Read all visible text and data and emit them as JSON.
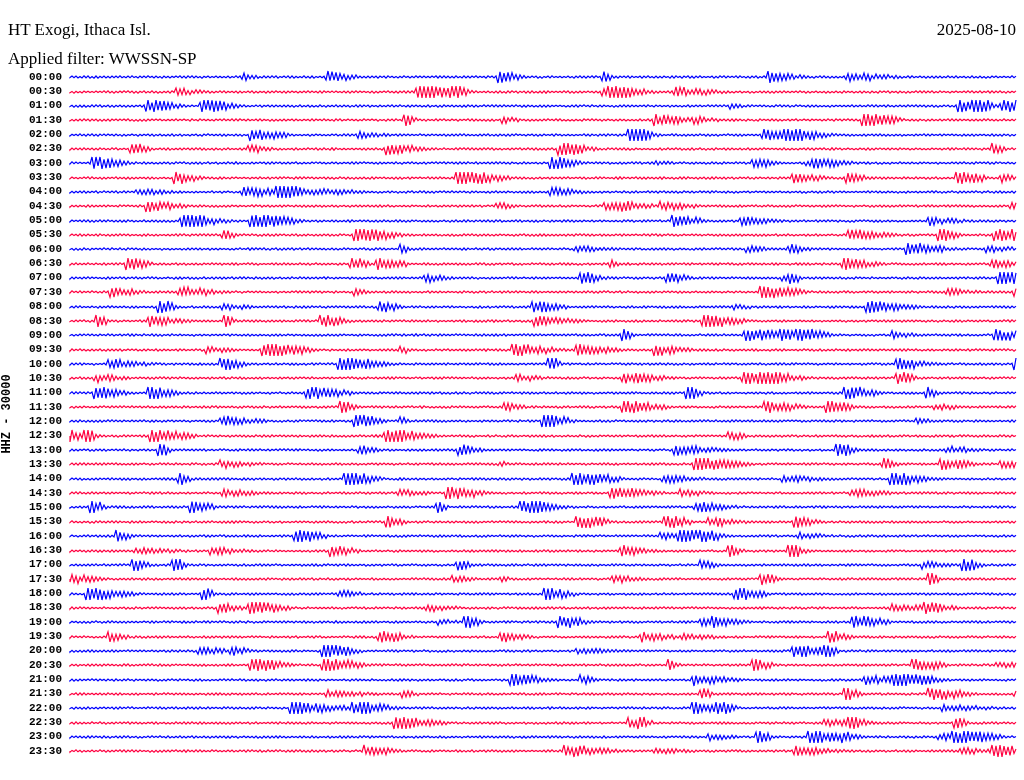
{
  "header": {
    "station": "HT Exogi, Ithaca Isl.",
    "date": "2025-08-10",
    "filter": "Applied filter: WWSSN-SP"
  },
  "channel_label": "HHZ - 30000",
  "traces": [
    {
      "time": "00:00",
      "color": "#0000ff"
    },
    {
      "time": "00:30",
      "color": "#ff0040"
    },
    {
      "time": "01:00",
      "color": "#0000ff"
    },
    {
      "time": "01:30",
      "color": "#ff0040"
    },
    {
      "time": "02:00",
      "color": "#0000ff"
    },
    {
      "time": "02:30",
      "color": "#ff0040"
    },
    {
      "time": "03:00",
      "color": "#0000ff"
    },
    {
      "time": "03:30",
      "color": "#ff0040"
    },
    {
      "time": "04:00",
      "color": "#0000ff"
    },
    {
      "time": "04:30",
      "color": "#ff0040"
    },
    {
      "time": "05:00",
      "color": "#0000ff"
    },
    {
      "time": "05:30",
      "color": "#ff0040"
    },
    {
      "time": "06:00",
      "color": "#0000ff"
    },
    {
      "time": "06:30",
      "color": "#ff0040"
    },
    {
      "time": "07:00",
      "color": "#0000ff"
    },
    {
      "time": "07:30",
      "color": "#ff0040"
    },
    {
      "time": "08:00",
      "color": "#0000ff"
    },
    {
      "time": "08:30",
      "color": "#ff0040"
    },
    {
      "time": "09:00",
      "color": "#0000ff"
    },
    {
      "time": "09:30",
      "color": "#ff0040"
    },
    {
      "time": "10:00",
      "color": "#0000ff"
    },
    {
      "time": "10:30",
      "color": "#ff0040"
    },
    {
      "time": "11:00",
      "color": "#0000ff"
    },
    {
      "time": "11:30",
      "color": "#ff0040"
    },
    {
      "time": "12:00",
      "color": "#0000ff"
    },
    {
      "time": "12:30",
      "color": "#ff0040"
    },
    {
      "time": "13:00",
      "color": "#0000ff"
    },
    {
      "time": "13:30",
      "color": "#ff0040"
    },
    {
      "time": "14:00",
      "color": "#0000ff"
    },
    {
      "time": "14:30",
      "color": "#ff0040"
    },
    {
      "time": "15:00",
      "color": "#0000ff"
    },
    {
      "time": "15:30",
      "color": "#ff0040"
    },
    {
      "time": "16:00",
      "color": "#0000ff"
    },
    {
      "time": "16:30",
      "color": "#ff0040"
    },
    {
      "time": "17:00",
      "color": "#0000ff"
    },
    {
      "time": "17:30",
      "color": "#ff0040"
    },
    {
      "time": "18:00",
      "color": "#0000ff"
    },
    {
      "time": "18:30",
      "color": "#ff0040"
    },
    {
      "time": "19:00",
      "color": "#0000ff"
    },
    {
      "time": "19:30",
      "color": "#ff0040"
    },
    {
      "time": "20:00",
      "color": "#0000ff"
    },
    {
      "time": "20:30",
      "color": "#ff0040"
    },
    {
      "time": "21:00",
      "color": "#0000ff"
    },
    {
      "time": "21:30",
      "color": "#ff0040"
    },
    {
      "time": "22:00",
      "color": "#0000ff"
    },
    {
      "time": "22:30",
      "color": "#ff0040"
    },
    {
      "time": "23:00",
      "color": "#0000ff"
    },
    {
      "time": "23:30",
      "color": "#ff0040"
    }
  ]
}
